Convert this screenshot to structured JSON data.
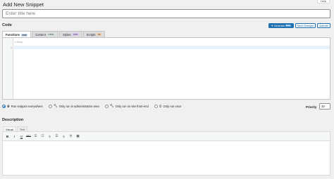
{
  "help_tab": "Help",
  "page_title": "Add New Snippet",
  "title_field": {
    "placeholder": "Enter title here",
    "value": ""
  },
  "code_section": {
    "label": "Code",
    "actions": {
      "generate": {
        "label": "Generate",
        "badge": "Beta"
      },
      "save": "Save Changes",
      "activate": "Activate"
    },
    "tabs": [
      {
        "label": "Functions",
        "tag": "PHP",
        "tag_color": "#c5d9ed",
        "active": true
      },
      {
        "label": "Content",
        "tag": "HTML",
        "tag_color": "#d1e4dd",
        "active": false
      },
      {
        "label": "Styles",
        "tag": "CSS",
        "tag_color": "#ddc7f2",
        "active": false
      },
      {
        "label": "Scripts",
        "tag": "JS",
        "tag_color": "#f5cba7",
        "active": false
      }
    ],
    "editor": {
      "lines": [
        {
          "number": "",
          "text": "<?php"
        },
        {
          "number": "1",
          "text": ""
        }
      ]
    }
  },
  "scope_options": [
    {
      "label": "Run snippet everywhere",
      "icon": "globe-icon",
      "checked": true
    },
    {
      "label": "Only run in administration area",
      "icon": "wrench-icon",
      "checked": false
    },
    {
      "label": "Only run on site front-end",
      "icon": "wrench-icon",
      "checked": false
    },
    {
      "label": "Only run once",
      "icon": "clock-icon",
      "checked": false
    }
  ],
  "priority": {
    "label": "Priority",
    "value": "10"
  },
  "description_section": {
    "label": "Description",
    "tabs": [
      {
        "label": "Visual",
        "active": true
      },
      {
        "label": "Text",
        "active": false
      }
    ],
    "toolbar": [
      {
        "name": "bold",
        "glyph": "B"
      },
      {
        "name": "italic",
        "glyph": "I"
      },
      {
        "name": "underline",
        "glyph": "U"
      },
      {
        "name": "strikethrough",
        "glyph": "ABC"
      },
      {
        "name": "unordered-list",
        "glyph": "☰"
      },
      {
        "name": "ordered-list",
        "glyph": "☷"
      },
      {
        "name": "align-left",
        "glyph": "≡"
      },
      {
        "name": "align-center",
        "glyph": "☰"
      },
      {
        "name": "align-right",
        "glyph": "≡"
      },
      {
        "name": "link",
        "glyph": "⚲"
      },
      {
        "name": "fullscreen",
        "glyph": "▦"
      }
    ]
  }
}
